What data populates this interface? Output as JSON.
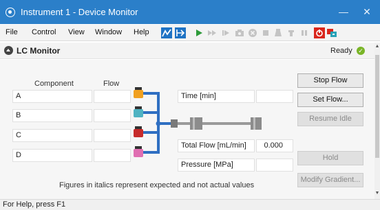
{
  "window": {
    "title": "Instrument 1 - Device Monitor",
    "minimize_glyph": "—",
    "close_glyph": "✕"
  },
  "menu": {
    "items": [
      "File",
      "Control",
      "View",
      "Window",
      "Help"
    ]
  },
  "toolbar": {
    "icons": [
      "chart-icon",
      "method-icon",
      "run-icon",
      "fast-forward-icon",
      "step-icon",
      "camera-icon",
      "stop-circle-icon",
      "stop-icon",
      "vial-icon",
      "valve-icon",
      "pause-icon",
      "power-icon",
      "network-icon"
    ],
    "accent": "#1f73c4",
    "run_color": "#2e9b3a",
    "alert_color": "#d9261c"
  },
  "section": {
    "title": "LC Monitor",
    "status": "Ready",
    "status_color": "#7ab528"
  },
  "table": {
    "headers": {
      "component": "Component",
      "flow": "Flow"
    },
    "rows": [
      {
        "component": "A",
        "flow": "",
        "bottle_color": "#f0a020"
      },
      {
        "component": "B",
        "flow": "",
        "bottle_color": "#4fb3c2"
      },
      {
        "component": "C",
        "flow": "",
        "bottle_color": "#c62b2b"
      },
      {
        "component": "D",
        "flow": "",
        "bottle_color": "#e06fb2"
      }
    ]
  },
  "readouts": {
    "time_label": "Time [min]",
    "time_value": "",
    "total_flow_label": "Total Flow [mL/min]",
    "total_flow_value": "0.000",
    "pressure_label": "Pressure [MPa]",
    "pressure_value": ""
  },
  "buttons": {
    "stop_flow": "Stop Flow",
    "set_flow": "Set Flow...",
    "resume_idle": "Resume Idle",
    "hold": "Hold",
    "modify_gradient": "Modify Gradient..."
  },
  "note": "Figures in italics represent expected and not actual values",
  "status_bar": "For Help, press F1",
  "tubing_color": "#2f6fc2"
}
